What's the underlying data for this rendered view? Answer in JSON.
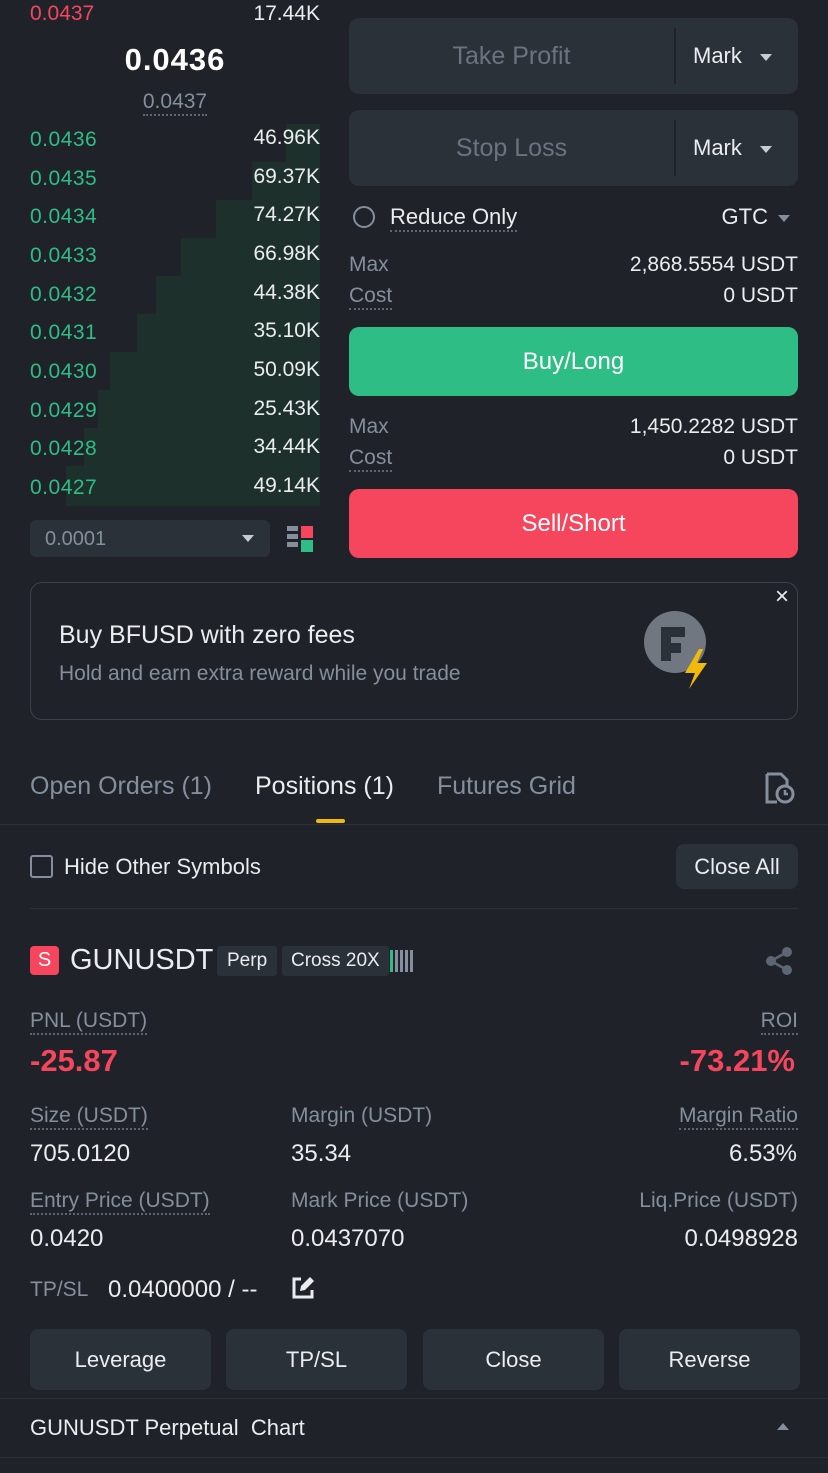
{
  "orderbook": {
    "top_partial": {
      "price": "0.0437",
      "amount": "17.44K"
    },
    "last_price": "0.0436",
    "mark_price": "0.0437",
    "bids": [
      {
        "price": "0.0436",
        "amount": "46.96K"
      },
      {
        "price": "0.0435",
        "amount": "69.37K"
      },
      {
        "price": "0.0434",
        "amount": "74.27K"
      },
      {
        "price": "0.0433",
        "amount": "66.98K"
      },
      {
        "price": "0.0432",
        "amount": "44.38K"
      },
      {
        "price": "0.0431",
        "amount": "35.10K"
      },
      {
        "price": "0.0430",
        "amount": "50.09K"
      },
      {
        "price": "0.0429",
        "amount": "25.43K"
      },
      {
        "price": "0.0428",
        "amount": "34.44K"
      },
      {
        "price": "0.0427",
        "amount": "49.14K"
      }
    ],
    "precision": "0.0001"
  },
  "order_form": {
    "take_profit": {
      "placeholder": "Take Profit",
      "type": "Mark"
    },
    "stop_loss": {
      "placeholder": "Stop Loss",
      "type": "Mark"
    },
    "reduce_only": "Reduce Only",
    "tif": "GTC",
    "buy": {
      "max_label": "Max",
      "max_value": "2,868.5554 USDT",
      "cost_label": "Cost",
      "cost_value": "0 USDT",
      "button": "Buy/Long"
    },
    "sell": {
      "max_label": "Max",
      "max_value": "1,450.2282 USDT",
      "cost_label": "Cost",
      "cost_value": "0 USDT",
      "button": "Sell/Short"
    }
  },
  "banner": {
    "title": "Buy BFUSD with zero fees",
    "subtitle": "Hold and earn extra reward while you trade",
    "close": "×"
  },
  "tabs": [
    {
      "label": "Open Orders (1)",
      "active": false
    },
    {
      "label": "Positions (1)",
      "active": true
    },
    {
      "label": "Futures Grid",
      "active": false
    }
  ],
  "filter": {
    "hide_other": "Hide Other Symbols",
    "close_all": "Close All"
  },
  "position": {
    "side_badge": "S",
    "symbol": "GUNUSDT",
    "type_tag": "Perp",
    "margin_tag": "Cross 20X",
    "pnl_label": "PNL (USDT)",
    "pnl_value": "-25.87",
    "roi_label": "ROI",
    "roi_value": "-73.21%",
    "size_label": "Size (USDT)",
    "size_value": "705.0120",
    "margin_label": "Margin (USDT)",
    "margin_value": "35.34",
    "margin_ratio_label": "Margin Ratio",
    "margin_ratio_value": "6.53%",
    "entry_label": "Entry Price (USDT)",
    "entry_value": "0.0420",
    "mark_label": "Mark Price (USDT)",
    "mark_value": "0.0437070",
    "liq_label": "Liq.Price (USDT)",
    "liq_value": "0.0498928",
    "tpsl_label": "TP/SL",
    "tpsl_value": "0.0400000 / --"
  },
  "actions": [
    "Leverage",
    "TP/SL",
    "Close",
    "Reverse"
  ],
  "footer": {
    "chart_label": "GUNUSDT Perpetual  Chart"
  },
  "colors": {
    "green": "#2ebd85",
    "red": "#f6465d",
    "bg": "#1f2329",
    "panel": "#2b3139",
    "accent": "#f0b90b"
  }
}
